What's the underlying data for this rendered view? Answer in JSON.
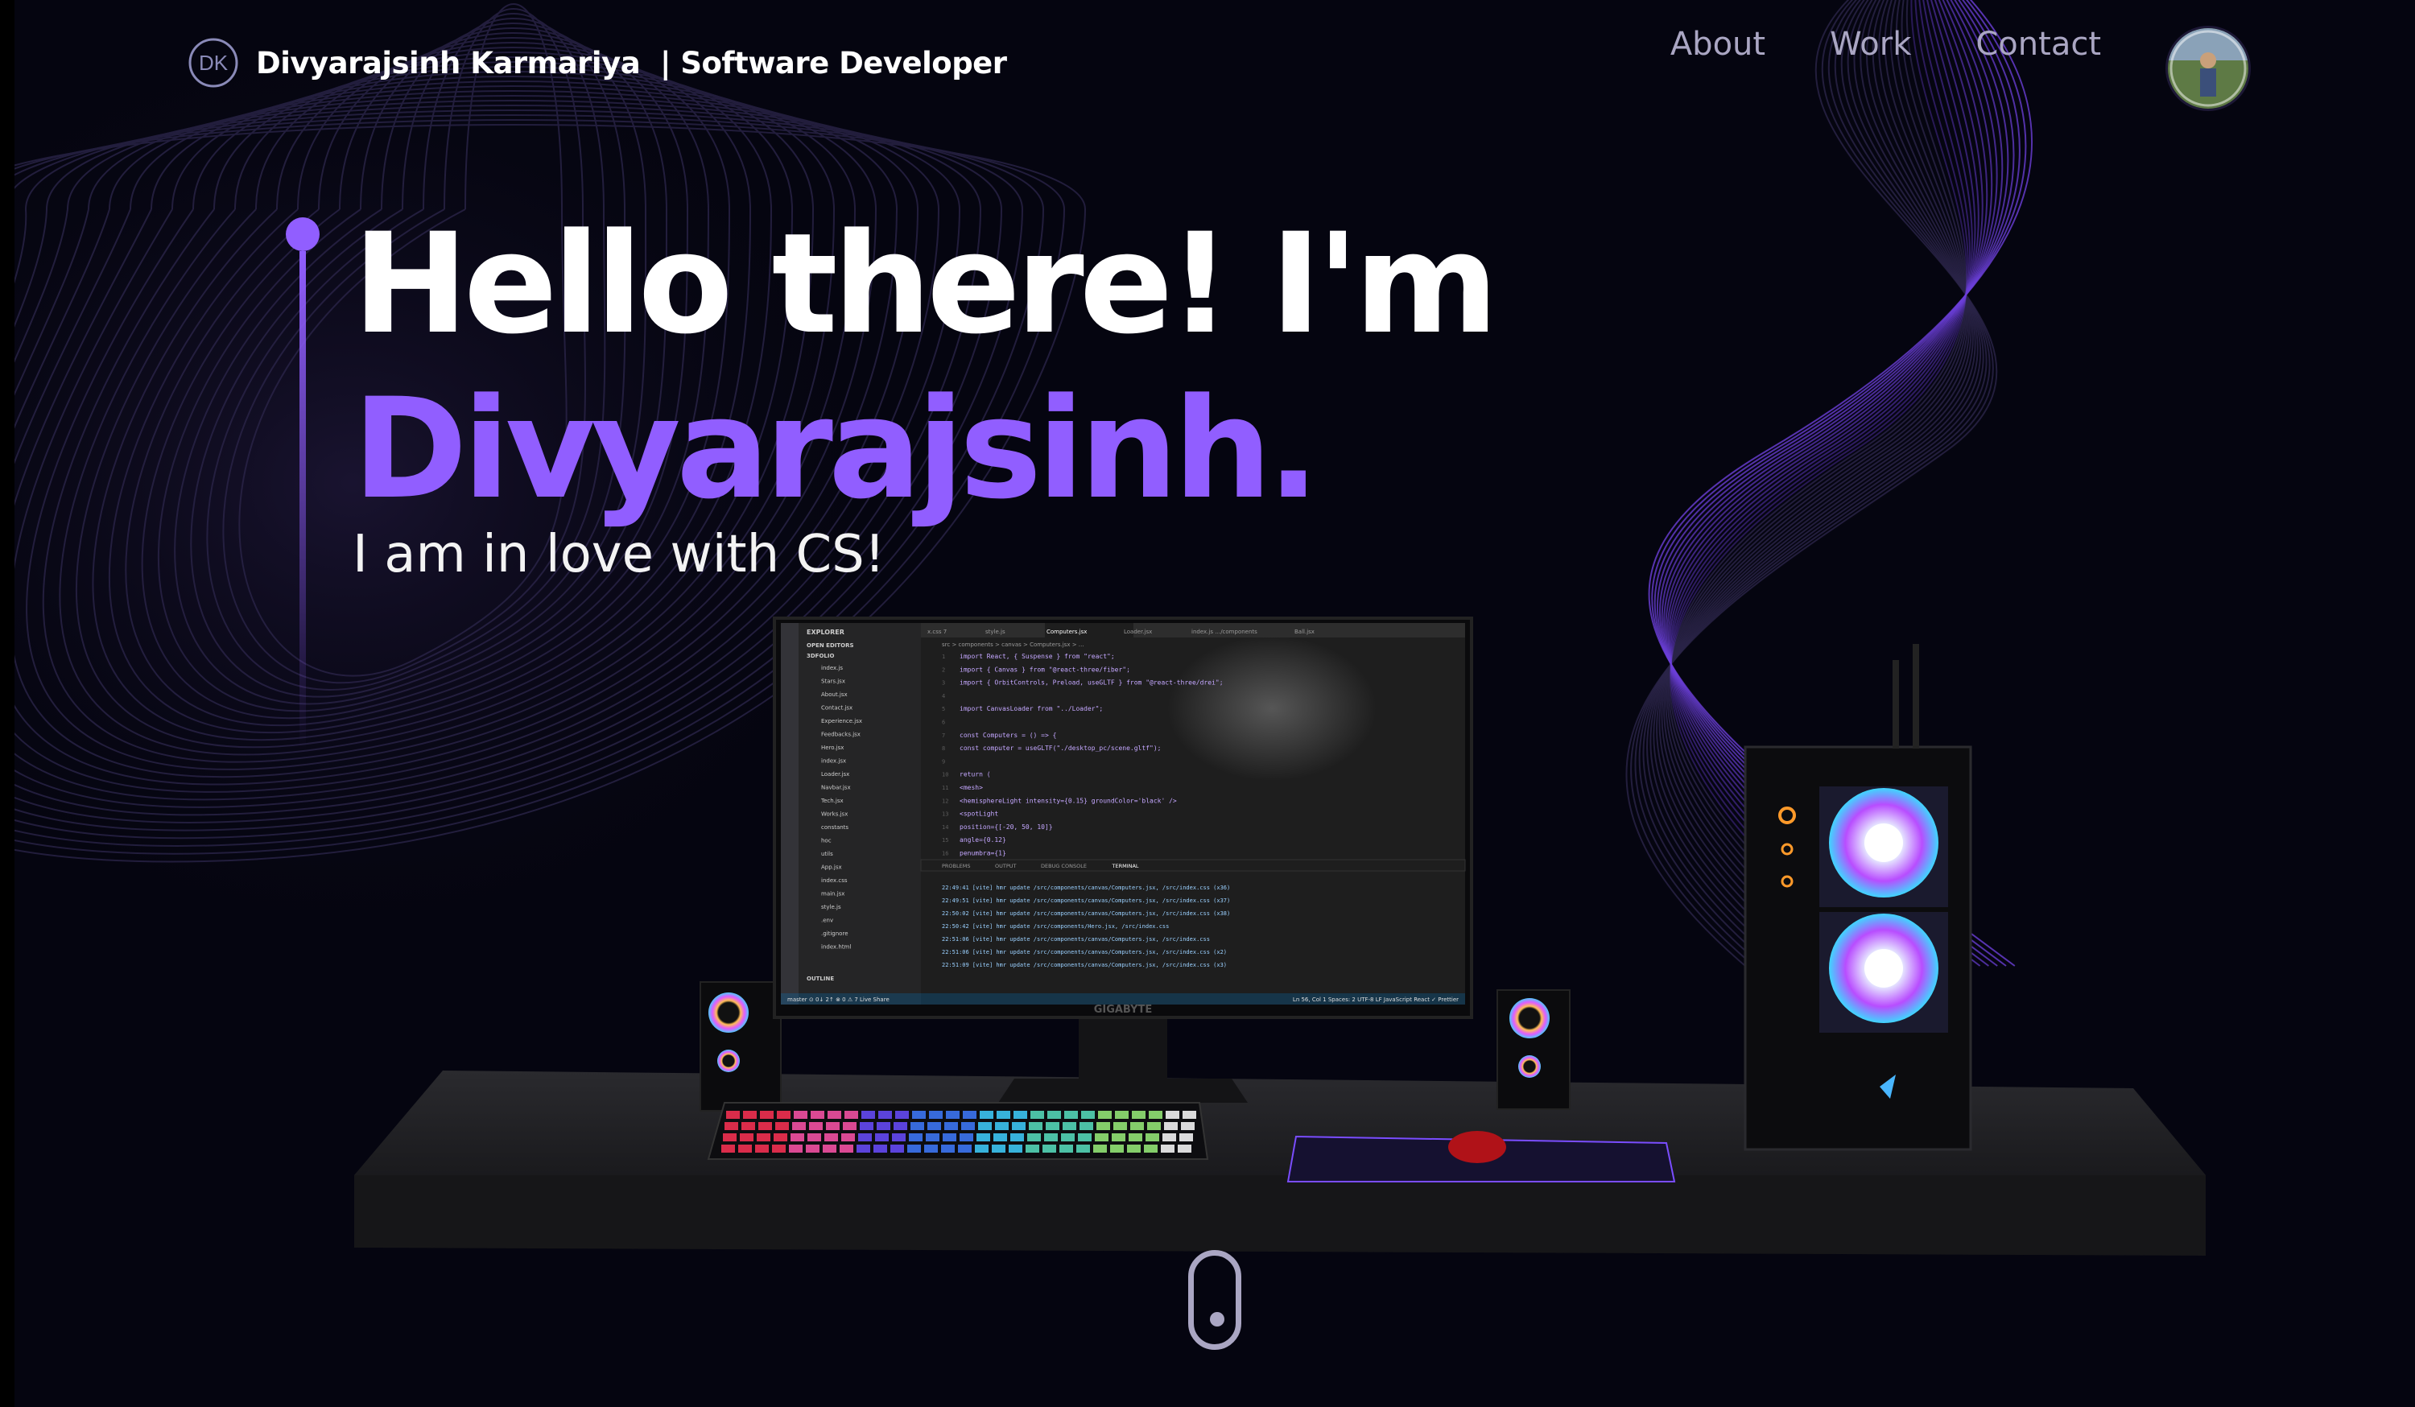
{
  "navbar": {
    "logo_text": "DK",
    "brand_name": "Divyarajsinh Karmariya  | Software Developer",
    "links": [
      {
        "label": "About"
      },
      {
        "label": "Work"
      },
      {
        "label": "Contact"
      }
    ]
  },
  "hero": {
    "heading": "Hello there! I'm",
    "name": "Divyarajsinh.",
    "subtitle": "I am in love with CS!"
  },
  "monitor": {
    "brand": "GIGABYTE",
    "editor_tabs": [
      "x.css 7",
      "style.js",
      "Computers.jsx",
      "Loader.jsx",
      "index.js …/components",
      "Ball.jsx"
    ],
    "breadcrumb": "src > components > canvas > Computers.jsx > …",
    "sidebar_title": "EXPLORER",
    "sidebar_sections": [
      "OPEN EDITORS",
      "3DFOLIO"
    ],
    "files": [
      "index.js",
      "Stars.jsx",
      "About.jsx",
      "Contact.jsx",
      "Experience.jsx",
      "Feedbacks.jsx",
      "Hero.jsx",
      "index.jsx",
      "Loader.jsx",
      "Navbar.jsx",
      "Tech.jsx",
      "Works.jsx",
      "constants",
      "hoc",
      "utils",
      "App.jsx",
      "index.css",
      "main.jsx",
      "style.js",
      ".env",
      ".gitignore",
      "index.html"
    ],
    "outline_label": "OUTLINE",
    "code_lines": [
      "import React, { Suspense } from \"react\";",
      "import { Canvas } from \"@react-three/fiber\";",
      "import { OrbitControls, Preload, useGLTF } from \"@react-three/drei\";",
      "",
      "import CanvasLoader from \"../Loader\";",
      "",
      "const Computers = () => {",
      "  const computer = useGLTF(\"./desktop_pc/scene.gltf\");",
      "",
      "  return (",
      "    <mesh>",
      "      <hemisphereLight intensity={0.15} groundColor='black' />",
      "      <spotLight",
      "        position={[-20, 50, 10]}",
      "        angle={0.12}",
      "        penumbra={1}"
    ],
    "panel_tabs": [
      "PROBLEMS",
      "OUTPUT",
      "DEBUG CONSOLE",
      "TERMINAL"
    ],
    "terminal_lines": [
      "22:49:41 [vite] hmr update /src/components/canvas/Computers.jsx, /src/index.css (x36)",
      "22:49:51 [vite] hmr update /src/components/canvas/Computers.jsx, /src/index.css (x37)",
      "22:50:02 [vite] hmr update /src/components/canvas/Computers.jsx, /src/index.css (x38)",
      "22:50:42 [vite] hmr update /src/components/Hero.jsx, /src/index.css",
      "22:51:06 [vite] hmr update /src/components/canvas/Computers.jsx, /src/index.css",
      "22:51:06 [vite] hmr update /src/components/canvas/Computers.jsx, /src/index.css (x2)",
      "22:51:09 [vite] hmr update /src/components/canvas/Computers.jsx, /src/index.css (x3)"
    ],
    "status_left": "master  ⊙ 0↓ 2↑  ⊗ 0 ⚠ 7  Live Share",
    "status_right": "Ln 56, Col 1  Spaces: 2  UTF-8  LF  JavaScript React  ✓ Prettier"
  },
  "colors": {
    "accent": "#915eff",
    "background": "#050510",
    "nav_text": "#aaa6c3",
    "white": "#ffffff"
  },
  "icons": {
    "logo": "dk-monogram-icon",
    "scroll": "scroll-mouse-icon"
  }
}
